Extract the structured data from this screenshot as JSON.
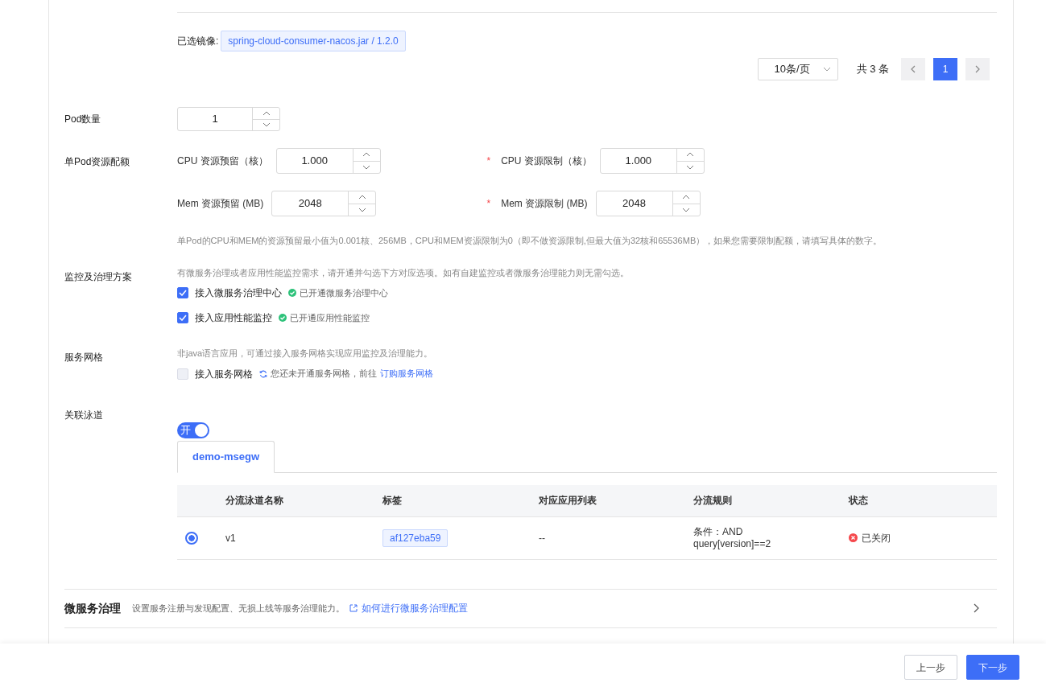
{
  "selected_image": {
    "label": "已选镜像:",
    "tag": "spring-cloud-consumer-nacos.jar / 1.2.0"
  },
  "pagination": {
    "page_size": "10条/页",
    "total": "共 3 条",
    "pages": [
      {
        "label": "1",
        "selected": true
      }
    ]
  },
  "pod_count": {
    "label": "Pod数量",
    "value": "1"
  },
  "quota": {
    "label": "单Pod资源配额",
    "fields": [
      {
        "label": "CPU 资源预留（核）",
        "value": "1.000",
        "required": false
      },
      {
        "label": "CPU 资源限制（核）",
        "value": "1.000",
        "required": true
      },
      {
        "label": "Mem 资源预留 (MB)",
        "value": "2048",
        "required": false
      },
      {
        "label": "Mem 资源限制 (MB)",
        "value": "2048",
        "required": true
      }
    ],
    "required_mark": "*",
    "help": "单Pod的CPU和MEM的资源预留最小值为0.001核、256MB，CPU和MEM资源限制为0（即不做资源限制,但最大值为32核和65536MB），如果您需要限制配额，请填写具体的数字。"
  },
  "monitoring": {
    "label": "监控及治理方案",
    "hint": "有微服务治理或者应用性能监控需求，请开通并勾选下方对应选项。如有自建监控或者微服务治理能力则无需勾选。",
    "options": [
      {
        "label": "接入微服务治理中心",
        "checked": true,
        "status": "已开通微服务治理中心",
        "kind": "ok"
      },
      {
        "label": "接入应用性能监控",
        "checked": true,
        "status": "已开通应用性能监控",
        "kind": "ok"
      }
    ]
  },
  "service_mesh": {
    "label": "服务网格",
    "hint": "非java语言应用，可通过接入服务网格实现应用监控及治理能力。",
    "options": [
      {
        "label": "接入服务网格",
        "checked": false,
        "disabled": true,
        "status": "您还未开通服务网格，前往",
        "kind": "pending",
        "link": "订购服务网格"
      }
    ]
  },
  "lane": {
    "label": "关联泳道",
    "toggle": {
      "on": true,
      "label": "开"
    },
    "tabs": [
      {
        "label": "demo-msegw",
        "selected": true
      }
    ],
    "table": {
      "columns": [
        "分流泳道名称",
        "标签",
        "对应应用列表",
        "分流规则",
        "状态"
      ],
      "rows": [
        {
          "selected": true,
          "name": "v1",
          "tag": "af127eba59",
          "apps": "--",
          "rule": [
            "条件：AND",
            "query[version]==2"
          ],
          "status": "已关闭",
          "color": "#f5484c"
        }
      ]
    }
  },
  "microservice": {
    "title": "微服务治理",
    "desc": "设置服务注册与发现配置、无损上线等服务治理能力。",
    "link": "如何进行微服务治理配置"
  },
  "footer": {
    "buttons": [
      {
        "label": "上一步",
        "kind": "secondary"
      },
      {
        "label": "下一步",
        "kind": "primary"
      }
    ]
  }
}
